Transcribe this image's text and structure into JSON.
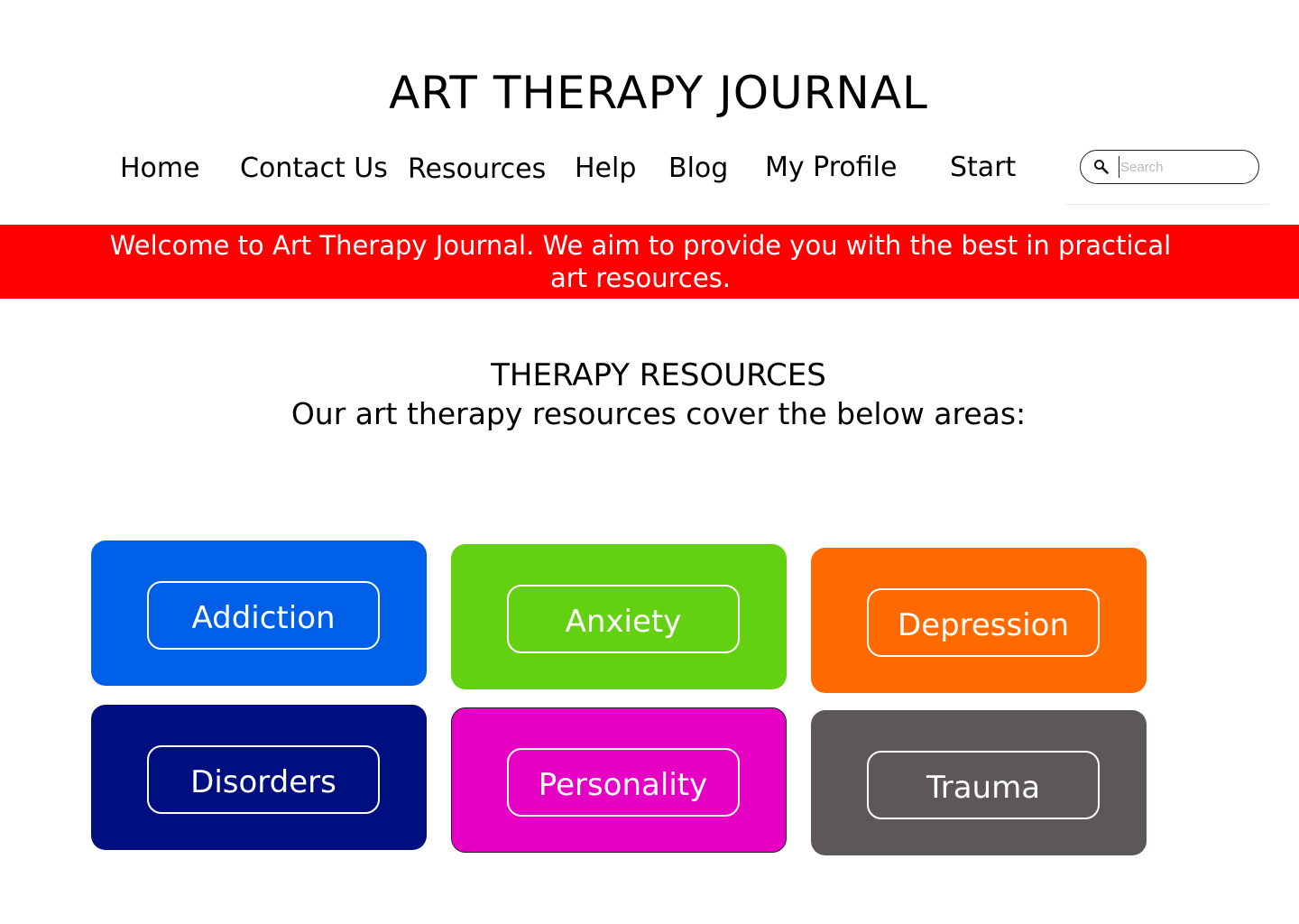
{
  "header": {
    "title": "ART THERAPY JOURNAL"
  },
  "nav": {
    "items": [
      {
        "label": "Home"
      },
      {
        "label": "Contact Us"
      },
      {
        "label": "Resources"
      },
      {
        "label": "Help"
      },
      {
        "label": "Blog"
      },
      {
        "label": "My Profile"
      },
      {
        "label": "Start"
      }
    ]
  },
  "search": {
    "placeholder": "Search",
    "value": "",
    "icon": "search-icon"
  },
  "banner": {
    "text": "Welcome to Art Therapy Journal. We aim to provide you with the best in practical art resources.",
    "color": "#ff0000"
  },
  "section": {
    "title": "THERAPY RESOURCES",
    "subtitle": "Our art therapy resources cover the below areas:"
  },
  "cards": [
    {
      "label": "Addiction",
      "color": "#005fe7"
    },
    {
      "label": "Anxiety",
      "color": "#63d112"
    },
    {
      "label": "Depression",
      "color": "#ff6a00"
    },
    {
      "label": "Disorders",
      "color": "#000f80"
    },
    {
      "label": "Personality",
      "color": "#e600c4"
    },
    {
      "label": "Trauma",
      "color": "#5c5859"
    }
  ]
}
